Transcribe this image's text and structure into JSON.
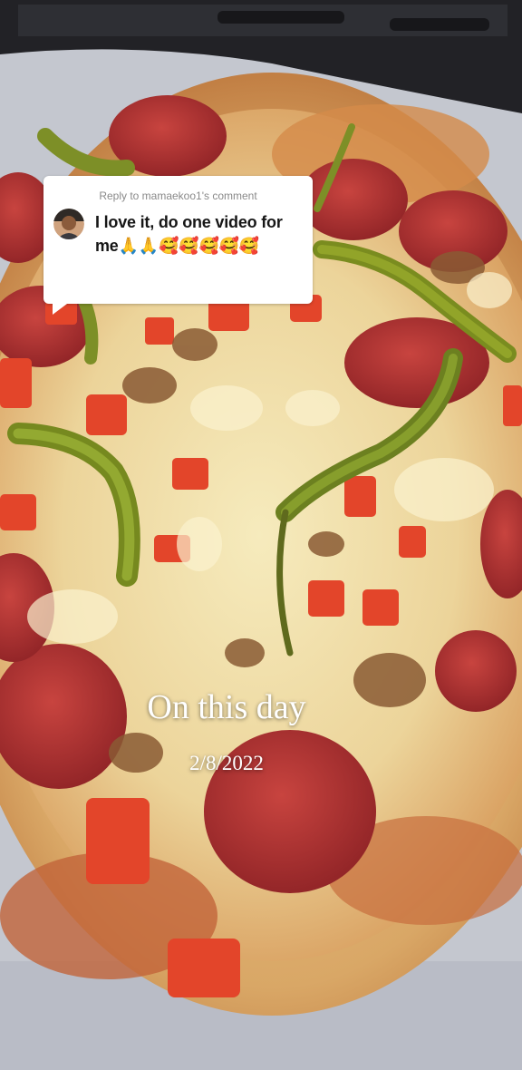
{
  "reply": {
    "header": "Reply to mamaekoo1's comment",
    "comment": "I love it, do one video for me🙏🙏🥰🥰🥰🥰🥰"
  },
  "memory": {
    "title": "On this day",
    "date": "2/8/2022"
  },
  "colors": {
    "card_background": "#ffffff",
    "card_text": "#161616",
    "card_header_text": "#8a8a8a",
    "overlay_text": "#ffffff"
  },
  "icons": [
    "profile-avatar",
    "folded-hands-emoji",
    "smiling-face-with-hearts-emoji"
  ]
}
